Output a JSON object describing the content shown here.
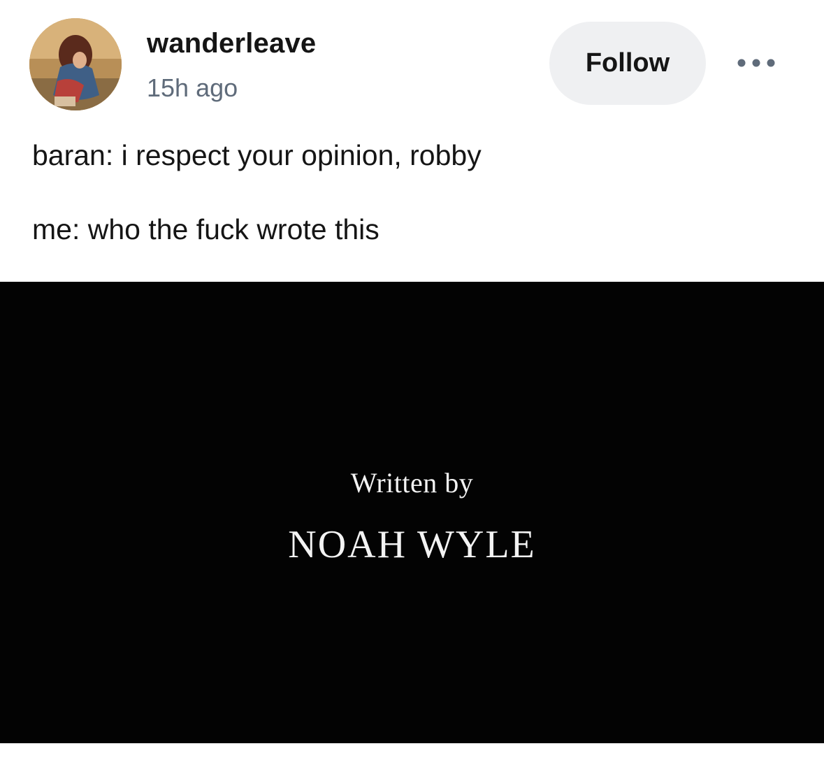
{
  "post": {
    "author": {
      "username": "wanderleave",
      "avatar_icon": "user-avatar-photo"
    },
    "timestamp": "15h ago",
    "follow_label": "Follow",
    "more_icon": "more-horizontal-icon",
    "text_lines": [
      "baran: i respect your opinion, robby",
      "me: who the fuck wrote this"
    ],
    "image": {
      "caption_line_1": "Written by",
      "caption_line_2": "NOAH WYLE",
      "background_color": "#030303",
      "text_color": "#f3f3f3"
    }
  },
  "colors": {
    "follow_button_bg": "#eff0f2",
    "timestamp": "#5f6b7a",
    "text": "#151515"
  }
}
